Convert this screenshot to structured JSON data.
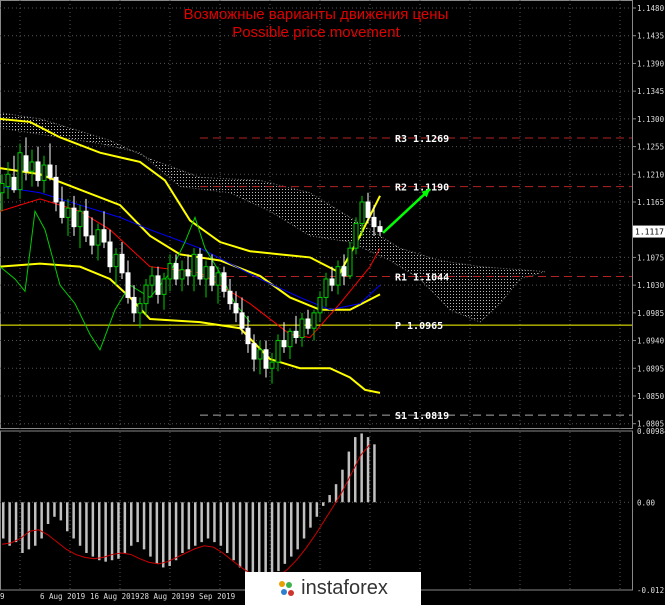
{
  "header": {
    "title_ru": "Возможные варианты движения цены",
    "title_en": "Possible price movement"
  },
  "logo": {
    "text": "instaforex"
  },
  "colors": {
    "background": "#000000",
    "grid": "#555555",
    "candle_up": "#00cc00",
    "candle_down": "#ffffff",
    "bollinger": "#ffff00",
    "kijun": "#0000ff",
    "tenkan": "#ff0000",
    "chikou": "#00cc00",
    "pivot_resistance": "#b22222",
    "pivot_main": "#ffff00",
    "forecast_arrow": "#00ff00",
    "macd_hist": "#c0c0c0",
    "macd_signal": "#cc0000",
    "price_label_bg": "#ffffff"
  },
  "chart_data": [
    {
      "type": "candlestick",
      "title": "",
      "current_price": "1.1117",
      "ylim": [
        1.0798,
        1.1493
      ],
      "y_ticks": [
        "1.1480",
        "1.1435",
        "1.1390",
        "1.1345",
        "1.1300",
        "1.1255",
        "1.1210",
        "1.1165",
        "1.1075",
        "1.1030",
        "1.0985",
        "1.0940",
        "1.0895",
        "1.0850",
        "1.0805"
      ],
      "x_ticks": [
        "9",
        "6 Aug 2019",
        "16 Aug 2019",
        "28 Aug 2019",
        "9 Sep 2019",
        "19 Se"
      ],
      "levels": [
        {
          "name": "R3",
          "label": "R3 1.1269",
          "value": 1.1269,
          "style": "dashed"
        },
        {
          "name": "R2",
          "label": "R2 1.1190",
          "value": 1.119,
          "style": "dashed"
        },
        {
          "name": "R1",
          "label": "R1 1.1044",
          "value": 1.1044,
          "style": "dashed"
        },
        {
          "name": "P",
          "label": "P 1.0965",
          "value": 1.0965,
          "style": "solid"
        },
        {
          "name": "S1",
          "label": "S1 1.0819",
          "value": 1.0819,
          "style": "dashed"
        }
      ],
      "forecast_arrow": {
        "from": 1.1115,
        "to": 1.1186
      }
    },
    {
      "type": "bar",
      "indicator": "MACD",
      "y_ticks": [
        "0.00984",
        "0.00",
        "-0.01211"
      ],
      "ylim": [
        -0.01211,
        0.00984
      ]
    }
  ]
}
